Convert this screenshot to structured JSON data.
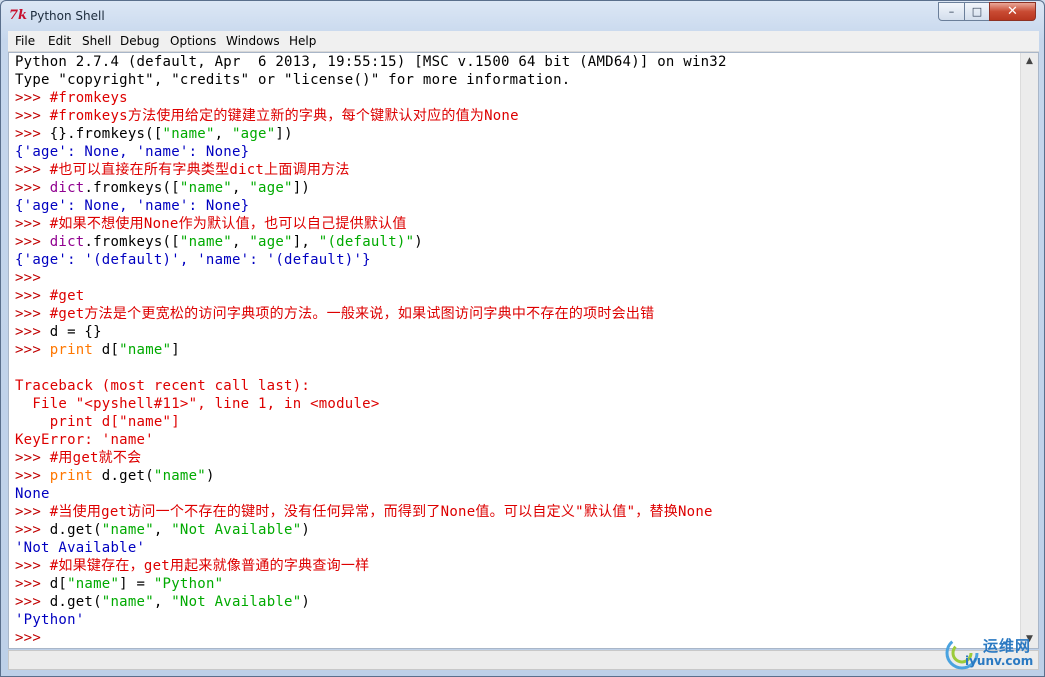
{
  "window": {
    "title": "Python Shell"
  },
  "titlebar": {
    "minimize_glyph": "–",
    "maximize_glyph": "□",
    "close_glyph": "✕"
  },
  "colors": {
    "stdout": "#000000",
    "prompt": "#c00000",
    "comment": "#dd0000",
    "keyword": "#ff7700",
    "builtin": "#900090",
    "string": "#00aa00",
    "result": "#0000c0",
    "error": "#dd0000"
  },
  "icons": [
    "python-tk-icon",
    "minimize-icon",
    "maximize-icon",
    "close-icon",
    "scroll-up-icon",
    "scroll-down-icon"
  ],
  "menu": [
    "File",
    "Edit",
    "Shell",
    "Debug",
    "Options",
    "Windows",
    "Help"
  ],
  "shell_lines": [
    [
      [
        "stdout",
        "Python 2.7.4 (default, Apr  6 2013, 19:55:15) [MSC v.1500 64 bit (AMD64)] on win32"
      ]
    ],
    [
      [
        "stdout",
        "Type \"copyright\", \"credits\" or \"license()\" for more information."
      ]
    ],
    [
      [
        "prompt",
        ">>> "
      ],
      [
        "comment",
        "#fromkeys"
      ]
    ],
    [
      [
        "prompt",
        ">>> "
      ],
      [
        "comment",
        "#fromkeys方法使用给定的键建立新的字典，每个键默认对应的值为None"
      ]
    ],
    [
      [
        "prompt",
        ">>> "
      ],
      [
        "stdout",
        "{}.fromkeys(["
      ],
      [
        "string",
        "\"name\""
      ],
      [
        "stdout",
        ", "
      ],
      [
        "string",
        "\"age\""
      ],
      [
        "stdout",
        "])"
      ]
    ],
    [
      [
        "result",
        "{'age': None, 'name': None}"
      ]
    ],
    [
      [
        "prompt",
        ">>> "
      ],
      [
        "comment",
        "#也可以直接在所有字典类型dict上面调用方法"
      ]
    ],
    [
      [
        "prompt",
        ">>> "
      ],
      [
        "builtin",
        "dict"
      ],
      [
        "stdout",
        ".fromkeys(["
      ],
      [
        "string",
        "\"name\""
      ],
      [
        "stdout",
        ", "
      ],
      [
        "string",
        "\"age\""
      ],
      [
        "stdout",
        "])"
      ]
    ],
    [
      [
        "result",
        "{'age': None, 'name': None}"
      ]
    ],
    [
      [
        "prompt",
        ">>> "
      ],
      [
        "comment",
        "#如果不想使用None作为默认值，也可以自己提供默认值"
      ]
    ],
    [
      [
        "prompt",
        ">>> "
      ],
      [
        "builtin",
        "dict"
      ],
      [
        "stdout",
        ".fromkeys(["
      ],
      [
        "string",
        "\"name\""
      ],
      [
        "stdout",
        ", "
      ],
      [
        "string",
        "\"age\""
      ],
      [
        "stdout",
        "], "
      ],
      [
        "string",
        "\"(default)\""
      ],
      [
        "stdout",
        ")"
      ]
    ],
    [
      [
        "result",
        "{'age': '(default)', 'name': '(default)'}"
      ]
    ],
    [
      [
        "prompt",
        ">>>"
      ]
    ],
    [
      [
        "prompt",
        ">>> "
      ],
      [
        "comment",
        "#get"
      ]
    ],
    [
      [
        "prompt",
        ">>> "
      ],
      [
        "comment",
        "#get方法是个更宽松的访问字典项的方法。一般来说，如果试图访问字典中不存在的项时会出错"
      ]
    ],
    [
      [
        "prompt",
        ">>> "
      ],
      [
        "stdout",
        "d = {}"
      ]
    ],
    [
      [
        "prompt",
        ">>> "
      ],
      [
        "keyword",
        "print"
      ],
      [
        "stdout",
        " d["
      ],
      [
        "string",
        "\"name\""
      ],
      [
        "stdout",
        "]"
      ]
    ],
    [
      [
        "stdout",
        ""
      ]
    ],
    [
      [
        "error",
        "Traceback (most recent call last):"
      ]
    ],
    [
      [
        "error",
        "  File \"<pyshell#11>\", line 1, in <module>"
      ]
    ],
    [
      [
        "error",
        "    print d[\"name\"]"
      ]
    ],
    [
      [
        "error",
        "KeyError: 'name'"
      ]
    ],
    [
      [
        "prompt",
        ">>> "
      ],
      [
        "comment",
        "#用get就不会"
      ]
    ],
    [
      [
        "prompt",
        ">>> "
      ],
      [
        "keyword",
        "print"
      ],
      [
        "stdout",
        " d.get("
      ],
      [
        "string",
        "\"name\""
      ],
      [
        "stdout",
        ")"
      ]
    ],
    [
      [
        "result",
        "None"
      ]
    ],
    [
      [
        "prompt",
        ">>> "
      ],
      [
        "comment",
        "#当使用get访问一个不存在的键时，没有任何异常，而得到了None值。可以自定义\"默认值\"，替换None"
      ]
    ],
    [
      [
        "prompt",
        ">>> "
      ],
      [
        "stdout",
        "d.get("
      ],
      [
        "string",
        "\"name\""
      ],
      [
        "stdout",
        ", "
      ],
      [
        "string",
        "\"Not Available\""
      ],
      [
        "stdout",
        ")"
      ]
    ],
    [
      [
        "result",
        "'Not Available'"
      ]
    ],
    [
      [
        "prompt",
        ">>> "
      ],
      [
        "comment",
        "#如果键存在，get用起来就像普通的字典查询一样"
      ]
    ],
    [
      [
        "prompt",
        ">>> "
      ],
      [
        "stdout",
        "d["
      ],
      [
        "string",
        "\"name\""
      ],
      [
        "stdout",
        "] = "
      ],
      [
        "string",
        "\"Python\""
      ]
    ],
    [
      [
        "prompt",
        ">>> "
      ],
      [
        "stdout",
        "d.get("
      ],
      [
        "string",
        "\"name\""
      ],
      [
        "stdout",
        ", "
      ],
      [
        "string",
        "\"Not Available\""
      ],
      [
        "stdout",
        ")"
      ]
    ],
    [
      [
        "result",
        "'Python'"
      ]
    ],
    [
      [
        "prompt",
        ">>>"
      ]
    ]
  ],
  "watermark": {
    "name": "运维网",
    "domain": "iyunv.com"
  }
}
